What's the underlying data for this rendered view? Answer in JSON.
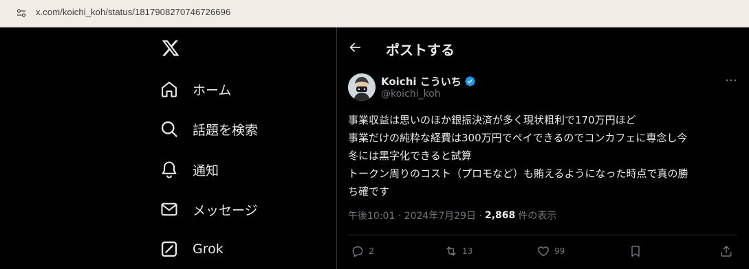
{
  "browser": {
    "url": "x.com/koichi_koh/status/1817908270746726696"
  },
  "nav": {
    "items": [
      {
        "label": "ホーム",
        "icon": "home-icon"
      },
      {
        "label": "話題を検索",
        "icon": "search-icon"
      },
      {
        "label": "通知",
        "icon": "bell-icon"
      },
      {
        "label": "メッセージ",
        "icon": "envelope-icon"
      },
      {
        "label": "Grok",
        "icon": "grok-icon"
      }
    ]
  },
  "header": {
    "title": "ポストする"
  },
  "post": {
    "author_name": "Koichi こういち",
    "handle": "@koichi_koh",
    "lines": [
      "事業収益は思いのほか銀振決済が多く現状粗利で170万円ほど",
      "事業だけの純粋な経費は300万円でペイできるのでコンカフェに専念し今",
      "冬には黒字化できると試算",
      "トークン周りのコスト（プロモなど）も賄えるようになった時点で真の勝",
      "ち確です"
    ],
    "timestamp": "午後10:01 · 2024年7月29日 · ",
    "views_count": "2,868",
    "views_label": "件の表示",
    "replies": "2",
    "reposts": "13",
    "likes": "99"
  },
  "colors": {
    "background": "#000000",
    "text": "#e7e9ea",
    "muted": "#71767b",
    "border": "#2f3336",
    "verified": "#1d9bf0"
  }
}
